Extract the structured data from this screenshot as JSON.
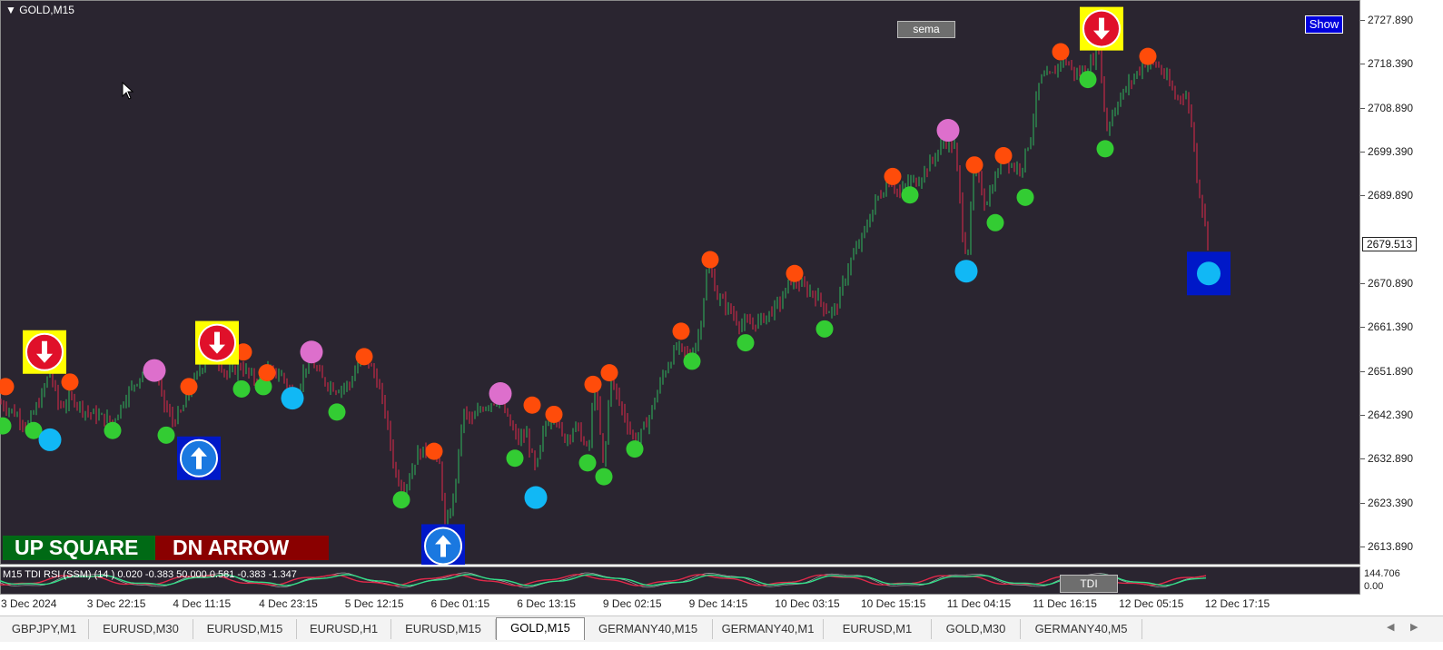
{
  "chart": {
    "symbol": "GOLD,M15",
    "sema_label": "sema",
    "show_label": "Show",
    "up_square_label": "UP SQUARE",
    "dn_arrow_label": "DN ARROW",
    "current_price": "2679.513",
    "price_labels": [
      "2727.890",
      "2718.390",
      "2708.890",
      "2699.390",
      "2689.890",
      "2670.890",
      "2661.390",
      "2651.890",
      "2642.390",
      "2632.890",
      "2623.390",
      "2613.890"
    ],
    "time_labels": [
      "3 Dec 2024",
      "3 Dec 22:15",
      "4 Dec 11:15",
      "4 Dec 23:15",
      "5 Dec 12:15",
      "6 Dec 01:15",
      "6 Dec 13:15",
      "9 Dec 02:15",
      "9 Dec 14:15",
      "10 Dec 03:15",
      "10 Dec 15:15",
      "11 Dec 04:15",
      "11 Dec 16:15",
      "12 Dec 05:15",
      "12 Dec 17:15"
    ],
    "colors": {
      "background": "#2a2530",
      "bull": "#2eb85c",
      "bear": "#e0294a",
      "dot_green": "#33cc33",
      "dot_orange": "#ff4c0a",
      "dot_pink": "#dd6fcc",
      "dot_cyan": "#11b8f5",
      "sell_box": "#ffff00",
      "buy_box": "#0018c8",
      "sell_icon": "#e0102a",
      "buy_icon": "#1a78e0"
    }
  },
  "indicator": {
    "label": "M15 TDI RSI (SSM) (14 ) 0.020 -0.383 50.000 0.581 -0.383 -1.347",
    "tdi_label": "TDI",
    "scale_top": "144.706",
    "scale_bottom": "0.00"
  },
  "tabs": [
    {
      "label": "GBPJPY,M1",
      "active": false
    },
    {
      "label": "EURUSD,M30",
      "active": false
    },
    {
      "label": "EURUSD,M15",
      "active": false
    },
    {
      "label": "EURUSD,H1",
      "active": false
    },
    {
      "label": "EURUSD,M15",
      "active": false
    },
    {
      "label": "GOLD,M15",
      "active": true
    },
    {
      "label": "GERMANY40,M15",
      "active": false
    },
    {
      "label": "GERMANY40,M1",
      "active": false
    },
    {
      "label": "EURUSD,M1",
      "active": false
    },
    {
      "label": "GOLD,M30",
      "active": false
    },
    {
      "label": "GERMANY40,M5",
      "active": false
    }
  ],
  "chart_data": {
    "type": "candlestick",
    "ylim": [
      2610,
      2731
    ],
    "price_path": [
      [
        0,
        2645
      ],
      [
        15,
        2643
      ],
      [
        30,
        2640
      ],
      [
        45,
        2646
      ],
      [
        55,
        2652
      ],
      [
        65,
        2644
      ],
      [
        80,
        2646
      ],
      [
        95,
        2643
      ],
      [
        110,
        2642
      ],
      [
        125,
        2641
      ],
      [
        140,
        2647
      ],
      [
        155,
        2651
      ],
      [
        170,
        2653
      ],
      [
        180,
        2645
      ],
      [
        190,
        2641
      ],
      [
        200,
        2643
      ],
      [
        210,
        2648
      ],
      [
        222,
        2653
      ],
      [
        235,
        2656
      ],
      [
        250,
        2651
      ],
      [
        265,
        2653
      ],
      [
        280,
        2650
      ],
      [
        295,
        2652
      ],
      [
        310,
        2651
      ],
      [
        325,
        2646
      ],
      [
        340,
        2655
      ],
      [
        355,
        2650
      ],
      [
        370,
        2648
      ],
      [
        385,
        2649
      ],
      [
        400,
        2656
      ],
      [
        415,
        2650
      ],
      [
        425,
        2642
      ],
      [
        435,
        2630
      ],
      [
        445,
        2626
      ],
      [
        460,
        2634
      ],
      [
        475,
        2635
      ],
      [
        485,
        2631
      ],
      [
        490,
        2617
      ],
      [
        500,
        2625
      ],
      [
        510,
        2643
      ],
      [
        520,
        2641
      ],
      [
        530,
        2644
      ],
      [
        550,
        2646
      ],
      [
        560,
        2641
      ],
      [
        570,
        2637
      ],
      [
        580,
        2638
      ],
      [
        590,
        2630
      ],
      [
        600,
        2640
      ],
      [
        610,
        2643
      ],
      [
        620,
        2637
      ],
      [
        635,
        2640
      ],
      [
        648,
        2634
      ],
      [
        655,
        2650
      ],
      [
        665,
        2630
      ],
      [
        672,
        2651
      ],
      [
        680,
        2646
      ],
      [
        690,
        2641
      ],
      [
        700,
        2636
      ],
      [
        715,
        2642
      ],
      [
        730,
        2651
      ],
      [
        745,
        2657
      ],
      [
        760,
        2655
      ],
      [
        770,
        2660
      ],
      [
        780,
        2676
      ],
      [
        790,
        2668
      ],
      [
        800,
        2666
      ],
      [
        815,
        2662
      ],
      [
        830,
        2662
      ],
      [
        845,
        2664
      ],
      [
        860,
        2667
      ],
      [
        872,
        2672
      ],
      [
        885,
        2670
      ],
      [
        900,
        2668
      ],
      [
        910,
        2665
      ],
      [
        920,
        2665
      ],
      [
        935,
        2675
      ],
      [
        950,
        2681
      ],
      [
        965,
        2689
      ],
      [
        980,
        2693
      ],
      [
        992,
        2690
      ],
      [
        1000,
        2693
      ],
      [
        1010,
        2693
      ],
      [
        1025,
        2697
      ],
      [
        1040,
        2702
      ],
      [
        1052,
        2700
      ],
      [
        1060,
        2682
      ],
      [
        1065,
        2676
      ],
      [
        1073,
        2697
      ],
      [
        1085,
        2688
      ],
      [
        1095,
        2693
      ],
      [
        1105,
        2699
      ],
      [
        1115,
        2696
      ],
      [
        1125,
        2696
      ],
      [
        1135,
        2703
      ],
      [
        1145,
        2715
      ],
      [
        1160,
        2716
      ],
      [
        1170,
        2720
      ],
      [
        1185,
        2716
      ],
      [
        1200,
        2718
      ],
      [
        1210,
        2722
      ],
      [
        1218,
        2704
      ],
      [
        1230,
        2710
      ],
      [
        1240,
        2713
      ],
      [
        1250,
        2716
      ],
      [
        1263,
        2719
      ],
      [
        1275,
        2718
      ],
      [
        1285,
        2715
      ],
      [
        1295,
        2711
      ],
      [
        1305,
        2712
      ],
      [
        1312,
        2706
      ],
      [
        1318,
        2694
      ],
      [
        1325,
        2686
      ],
      [
        1330,
        2680
      ]
    ],
    "markers": [
      {
        "type": "dot",
        "color": "orange",
        "x": 6,
        "y": 2648.5
      },
      {
        "type": "dot",
        "color": "green",
        "x": 3,
        "y": 2640
      },
      {
        "type": "dot",
        "color": "green",
        "x": 37,
        "y": 2639
      },
      {
        "type": "dot",
        "color": "cyan",
        "x": 55,
        "y": 2637
      },
      {
        "type": "dot",
        "color": "orange",
        "x": 77,
        "y": 2649.5
      },
      {
        "type": "dot",
        "color": "green",
        "x": 124,
        "y": 2639
      },
      {
        "type": "dot",
        "color": "pink",
        "x": 170,
        "y": 2652
      },
      {
        "type": "dot",
        "color": "green",
        "x": 183,
        "y": 2638
      },
      {
        "type": "dot",
        "color": "orange",
        "x": 208,
        "y": 2648.5
      },
      {
        "type": "dot",
        "color": "orange",
        "x": 268,
        "y": 2656
      },
      {
        "type": "dot",
        "color": "green",
        "x": 266,
        "y": 2648
      },
      {
        "type": "dot",
        "color": "green",
        "x": 290,
        "y": 2648.5
      },
      {
        "type": "dot",
        "color": "orange",
        "x": 294,
        "y": 2651.5
      },
      {
        "type": "dot",
        "color": "cyan",
        "x": 322,
        "y": 2646
      },
      {
        "type": "dot",
        "color": "pink",
        "x": 343,
        "y": 2656
      },
      {
        "type": "dot",
        "color": "green",
        "x": 371,
        "y": 2643
      },
      {
        "type": "dot",
        "color": "orange",
        "x": 401,
        "y": 2655
      },
      {
        "type": "dot",
        "color": "green",
        "x": 442,
        "y": 2624
      },
      {
        "type": "dot",
        "color": "orange",
        "x": 478,
        "y": 2634.5
      },
      {
        "type": "dot",
        "color": "pink",
        "x": 551,
        "y": 2647
      },
      {
        "type": "dot",
        "color": "orange",
        "x": 586,
        "y": 2644.5
      },
      {
        "type": "dot",
        "color": "green",
        "x": 567,
        "y": 2633
      },
      {
        "type": "dot",
        "color": "orange",
        "x": 610,
        "y": 2642.5
      },
      {
        "type": "dot",
        "color": "cyan",
        "x": 590,
        "y": 2624.5
      },
      {
        "type": "dot",
        "color": "green",
        "x": 647,
        "y": 2632
      },
      {
        "type": "dot",
        "color": "orange",
        "x": 653,
        "y": 2649
      },
      {
        "type": "dot",
        "color": "orange",
        "x": 671,
        "y": 2651.5
      },
      {
        "type": "dot",
        "color": "green",
        "x": 665,
        "y": 2629
      },
      {
        "type": "dot",
        "color": "green",
        "x": 699,
        "y": 2635
      },
      {
        "type": "dot",
        "color": "orange",
        "x": 750,
        "y": 2660.5
      },
      {
        "type": "dot",
        "color": "green",
        "x": 762,
        "y": 2654
      },
      {
        "type": "dot",
        "color": "orange",
        "x": 782,
        "y": 2676
      },
      {
        "type": "dot",
        "color": "green",
        "x": 821,
        "y": 2658
      },
      {
        "type": "dot",
        "color": "orange",
        "x": 875,
        "y": 2673
      },
      {
        "type": "dot",
        "color": "green",
        "x": 908,
        "y": 2661
      },
      {
        "type": "dot",
        "color": "orange",
        "x": 983,
        "y": 2694
      },
      {
        "type": "dot",
        "color": "green",
        "x": 1002,
        "y": 2690
      },
      {
        "type": "dot",
        "color": "pink",
        "x": 1044,
        "y": 2704
      },
      {
        "type": "dot",
        "color": "orange",
        "x": 1073,
        "y": 2696.5
      },
      {
        "type": "dot",
        "color": "orange",
        "x": 1105,
        "y": 2698.5
      },
      {
        "type": "dot",
        "color": "green",
        "x": 1096,
        "y": 2684
      },
      {
        "type": "dot",
        "color": "cyan",
        "x": 1064,
        "y": 2673.5
      },
      {
        "type": "dot",
        "color": "green",
        "x": 1129,
        "y": 2689.5
      },
      {
        "type": "dot",
        "color": "orange",
        "x": 1168,
        "y": 2721
      },
      {
        "type": "dot",
        "color": "green",
        "x": 1198,
        "y": 2715
      },
      {
        "type": "dot",
        "color": "green",
        "x": 1217,
        "y": 2700
      },
      {
        "type": "dot",
        "color": "orange",
        "x": 1264,
        "y": 2720
      },
      {
        "type": "sell-box",
        "x": 49,
        "y": 2656
      },
      {
        "type": "sell-box",
        "x": 239,
        "y": 2658
      },
      {
        "type": "sell-box",
        "x": 1213,
        "y": 2726
      },
      {
        "type": "buy-box",
        "x": 219,
        "y": 2633
      },
      {
        "type": "buy-box",
        "x": 488,
        "y": 2614
      },
      {
        "type": "buy-box",
        "x": 1331,
        "y": 2673
      }
    ]
  }
}
